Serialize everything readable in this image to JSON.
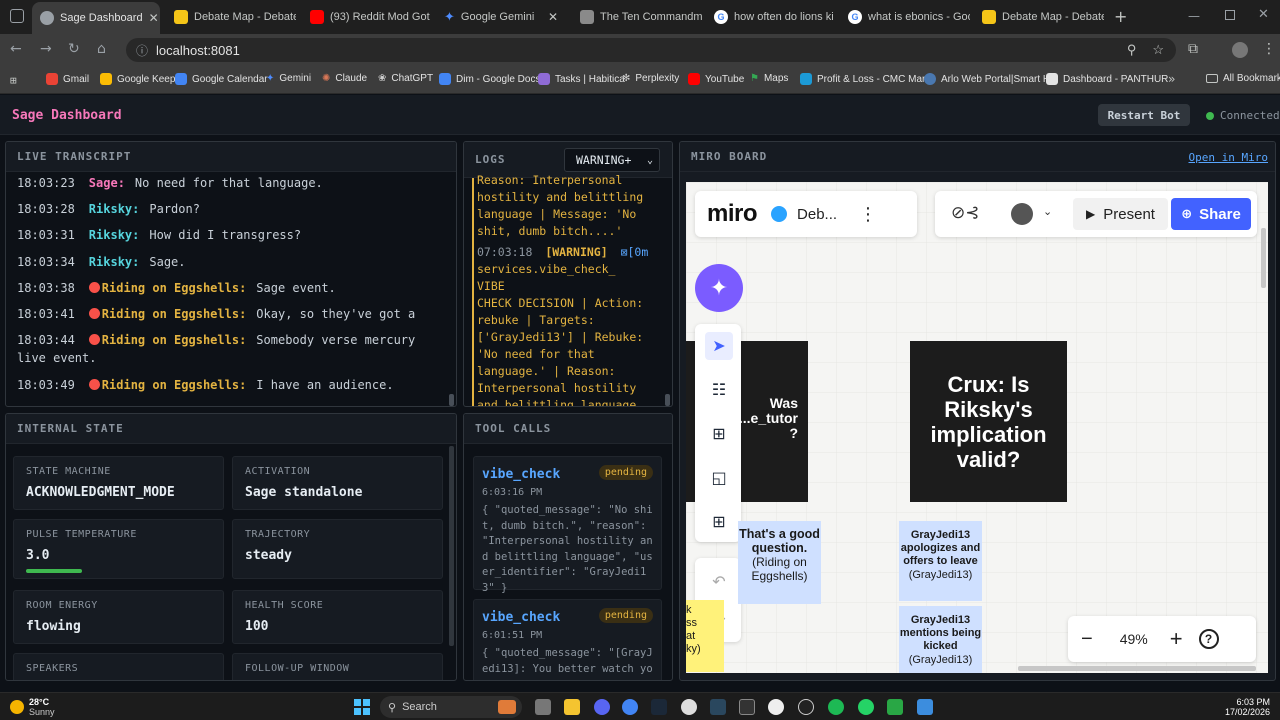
{
  "browser": {
    "tabs": [
      {
        "title": "Sage Dashboard",
        "color": "#9aa0a6",
        "active": true
      },
      {
        "title": "Debate Map - Debate",
        "color": "#f5c518"
      },
      {
        "title": "(93) Reddit Mod Got",
        "color": "#ff0000"
      },
      {
        "title": "Google Gemini",
        "color": "#4e8cff"
      },
      {
        "title": "The Ten Commandme",
        "color": "#8a8a8a"
      },
      {
        "title": "how often do lions ki",
        "color": "#e3e3e3"
      },
      {
        "title": "what is ebonics - Goo",
        "color": "#e3e3e3"
      },
      {
        "title": "Debate Map - Debate",
        "color": "#f5c518"
      }
    ],
    "url": "localhost:8081",
    "bookmarks": [
      {
        "label": "Gmail",
        "color": "#ea4335"
      },
      {
        "label": "Google Keep",
        "color": "#fbbc04"
      },
      {
        "label": "Google Calendar",
        "color": "#4285f4"
      },
      {
        "label": "Gemini",
        "color": "#4e8cff"
      },
      {
        "label": "Claude",
        "color": "#d97757"
      },
      {
        "label": "ChatGPT",
        "color": "#cfcfcf"
      },
      {
        "label": "Dim - Google Docs",
        "color": "#4285f4"
      },
      {
        "label": "Tasks | Habitica",
        "color": "#8f6bd6"
      },
      {
        "label": "Perplexity",
        "color": "#cfcfcf"
      },
      {
        "label": "YouTube",
        "color": "#ff0000"
      },
      {
        "label": "Maps",
        "color": "#34a853"
      },
      {
        "label": "Profit & Loss - CMC Mar...",
        "color": "#1c9ad6"
      },
      {
        "label": "Arlo Web Portal|Smart H...",
        "color": "#4a78b0"
      },
      {
        "label": "Dashboard - PANTHUR",
        "color": "#e3e3e3"
      }
    ],
    "all_bookmarks": "All Bookmarks"
  },
  "app": {
    "title": "Sage Dashboard",
    "restart_label": "Restart Bot",
    "status": "Connected"
  },
  "transcript": {
    "header": "LIVE TRANSCRIPT",
    "lines": [
      {
        "time": "18:03:23",
        "speaker": "Sage:",
        "text": "No need for that language."
      },
      {
        "time": "18:03:28",
        "speaker": "Riksky:",
        "text": "Pardon?"
      },
      {
        "time": "18:03:31",
        "speaker": "Riksky:",
        "text": "How did I transgress?"
      },
      {
        "time": "18:03:34",
        "speaker": "Riksky:",
        "text": "Sage."
      },
      {
        "time": "18:03:38",
        "speaker": "Riding on Eggshells:",
        "text": "Sage event."
      },
      {
        "time": "18:03:41",
        "speaker": "Riding on Eggshells:",
        "text": "Okay, so they've got a"
      },
      {
        "time": "18:03:44",
        "speaker": "Riding on Eggshells:",
        "text": "Somebody verse mercury",
        "cont": "live event."
      },
      {
        "time": "18:03:49",
        "speaker": "Riding on Eggshells:",
        "text": "I have an audience."
      }
    ]
  },
  "logs": {
    "header": "LOGS",
    "filter": "WARNING+",
    "entry1": "Reason: Interpersonal\nhostility and belittling\nlanguage | Message: 'No\nshit, dumb bitch....'",
    "entry2_time": "07:03:18",
    "entry2_level": "[WARNING]",
    "entry2_code": "⊠[0m",
    "entry2": "services.vibe_check_ VIBE\nCHECK DECISION | Action:\nrebuke | Targets:\n['GrayJedi13'] | Rebuke:\n'No need for that\nlanguage.' | Reason:\nInterpersonal hostility\nand belittling language"
  },
  "state": {
    "header": "INTERNAL STATE",
    "cards": [
      {
        "label": "STATE MACHINE",
        "value": "ACKNOWLEDGMENT_MODE"
      },
      {
        "label": "ACTIVATION",
        "value": "Sage standalone"
      },
      {
        "label": "PULSE TEMPERATURE",
        "value": "3.0"
      },
      {
        "label": "TRAJECTORY",
        "value": "steady"
      },
      {
        "label": "ROOM ENERGY",
        "value": "flowing"
      },
      {
        "label": "HEALTH SCORE",
        "value": "100"
      },
      {
        "label": "SPEAKERS",
        "value": ""
      },
      {
        "label": "FOLLOW-UP WINDOW",
        "value": ""
      }
    ],
    "pulse_level": 0.3,
    "pulse_color": "#3fb950"
  },
  "tools": {
    "header": "TOOL CALLS",
    "calls": [
      {
        "name": "vibe_check",
        "status": "pending",
        "time": "6:03:16 PM",
        "body": "{ \"quoted_message\": \"No shit, dumb bitch.\", \"reason\": \"Interpersonal hostility and belittling language\", \"user_identifier\": \"GrayJedi13\" }"
      },
      {
        "name": "vibe_check",
        "status": "pending",
        "time": "6:01:51 PM",
        "body": "{ \"quoted_message\": \"[GrayJedi13]: You better watch your"
      }
    ]
  },
  "miro": {
    "header": "MIRO BOARD",
    "open_link": "Open in Miro",
    "logo": "miro",
    "board_name": "Deb...",
    "present": "Present",
    "share": "Share",
    "zoom": "49%",
    "frame1_text": "Was\nr...e_tutor\n?",
    "frame2_text": "Crux: Is Riksky's implication valid?",
    "sticky1": "That's a good question.",
    "sticky1_author": "(Riding on Eggshells)",
    "sticky2": "GrayJedi13 apologizes and offers to leave",
    "sticky2_author": "(GrayJedi13)",
    "sticky3": "GrayJedi13 mentions being kicked",
    "sticky3_author": "(GrayJedi13)",
    "sticky4": "k\nss\nat\nky)"
  },
  "taskbar": {
    "weather_temp": "28°C",
    "weather_desc": "Sunny",
    "search": "Search",
    "time": "6:03 PM",
    "date": "17/02/2026"
  }
}
